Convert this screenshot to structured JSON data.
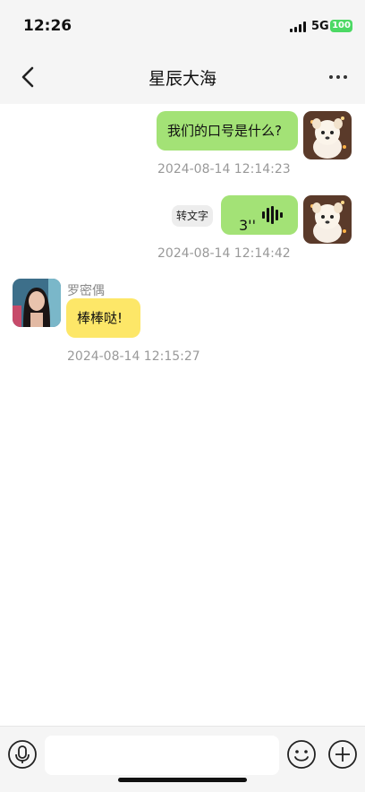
{
  "status": {
    "time": "12:26",
    "network": "5G",
    "battery": "100"
  },
  "nav": {
    "title": "星辰大海",
    "back_icon": "chevron-left-icon",
    "more_icon": "ellipsis-icon"
  },
  "messages": [
    {
      "sender": "me",
      "type": "text",
      "text": "我们的口号是什么?",
      "timestamp": "2024-08-14 12:14:23"
    },
    {
      "sender": "me",
      "type": "voice",
      "duration": "3''",
      "convert_label": "转文字",
      "timestamp": "2024-08-14 12:14:42"
    },
    {
      "sender": "other",
      "name": "罗密偶",
      "type": "text",
      "text": "棒棒哒!",
      "timestamp": "2024-08-14 12:15:27"
    }
  ],
  "bottom": {
    "voice_icon": "microphone-icon",
    "emoji_icon": "emoji-icon",
    "plus_icon": "plus-icon"
  },
  "colors": {
    "my_bubble": "#a3e276",
    "other_bubble": "#fde768",
    "bar_bg": "#f5f5f5",
    "battery": "#4cd964"
  }
}
